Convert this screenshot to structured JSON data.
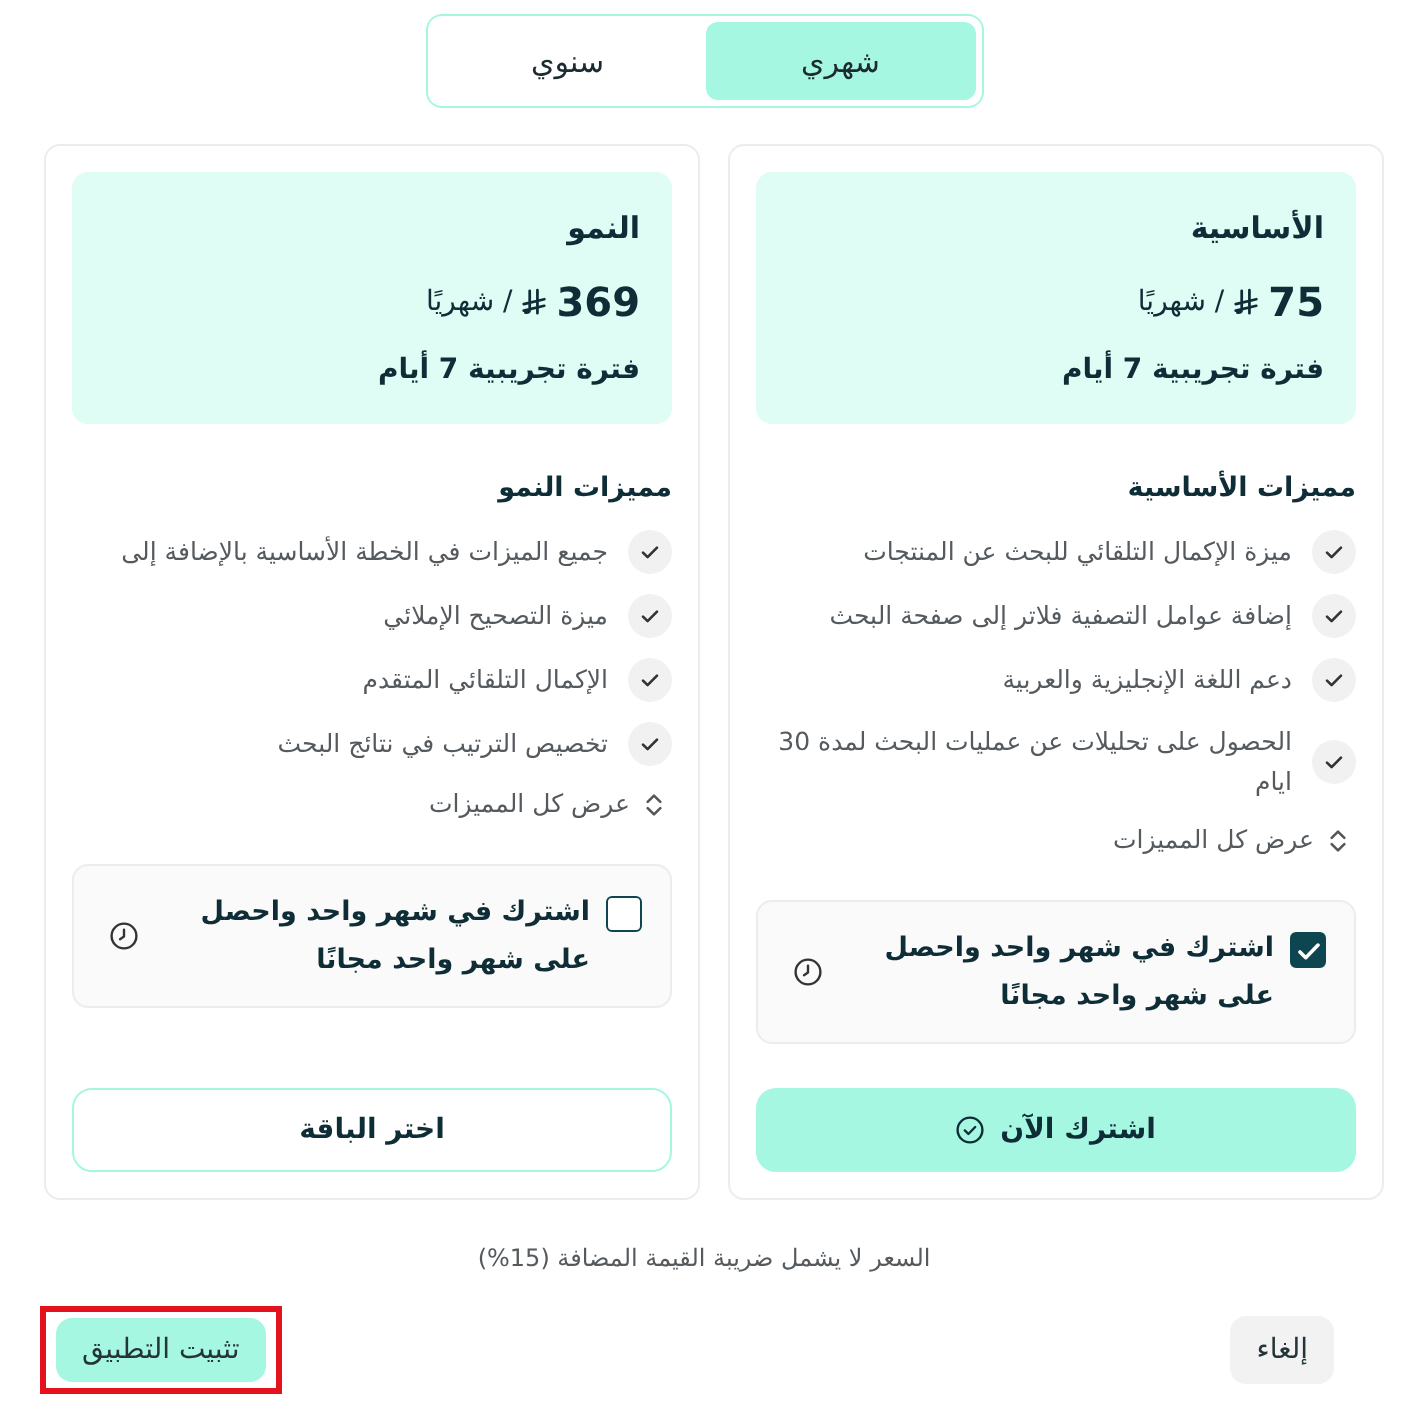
{
  "billing_toggle": {
    "options": [
      {
        "label": "شهري",
        "selected": true
      },
      {
        "label": "سنوي",
        "selected": false
      }
    ]
  },
  "plans": [
    {
      "name": "الأساسية",
      "price": "75",
      "period": "/ شهريًا",
      "trial": "فترة تجريبية 7 أيام",
      "features_title": "مميزات الأساسية",
      "features": [
        "ميزة الإكمال التلقائي للبحث عن المنتجات",
        "إضافة عوامل التصفية فلاتر إلى صفحة البحث",
        "دعم اللغة الإنجليزية والعربية",
        "الحصول على تحليلات عن عمليات البحث لمدة 30 ايام"
      ],
      "show_all": "عرض كل المميزات",
      "offer": {
        "text": "اشترك في شهر واحد واحصل على شهر واحد مجانًا",
        "checked": true
      },
      "button": {
        "label": "اشترك الآن",
        "kind": "primary"
      }
    },
    {
      "name": "النمو",
      "price": "369",
      "period": "/ شهريًا",
      "trial": "فترة تجريبية 7 أيام",
      "features_title": "مميزات النمو",
      "features": [
        "جميع الميزات في الخطة الأساسية بالإضافة إلى",
        "ميزة التصحيح الإملائي",
        "الإكمال التلقائي المتقدم",
        "تخصيص الترتيب في نتائج البحث"
      ],
      "show_all": "عرض كل المميزات",
      "offer": {
        "text": "اشترك في شهر واحد واحصل على شهر واحد مجانًا",
        "checked": false
      },
      "button": {
        "label": "اختر الباقة",
        "kind": "outline"
      }
    }
  ],
  "tax_note": "السعر لا يشمل ضريبة القيمة المضافة (15%)",
  "footer": {
    "buttons": [
      {
        "label": "إلغاء",
        "kind": "secondary",
        "highlighted": false
      },
      {
        "label": "تثبيت التطبيق",
        "kind": "primary",
        "highlighted": true
      }
    ]
  }
}
